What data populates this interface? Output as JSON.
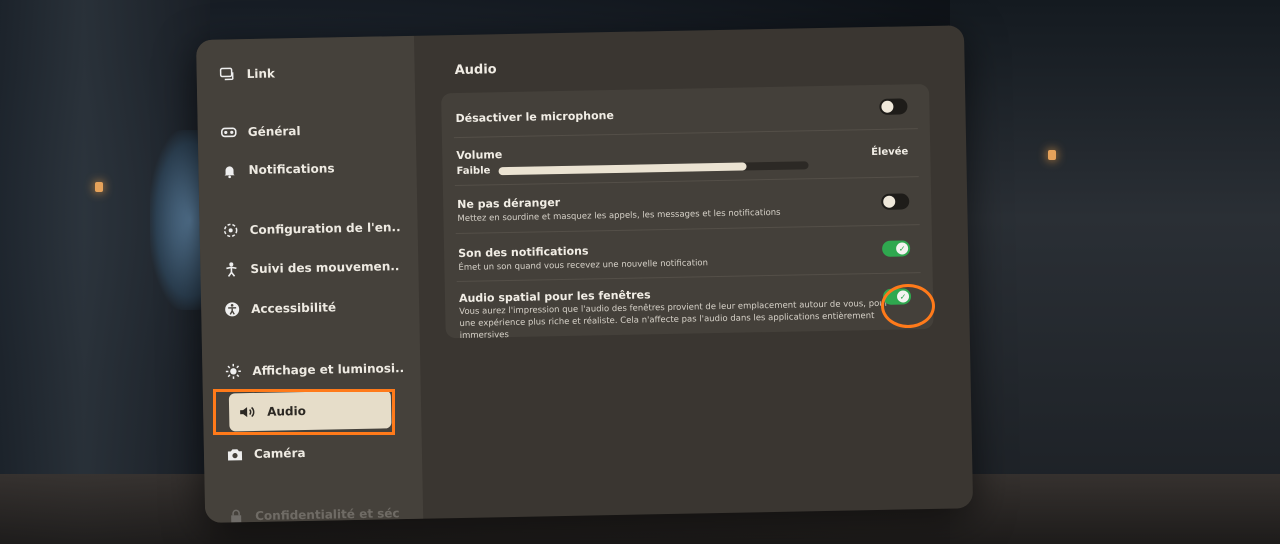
{
  "sidebar": {
    "items": [
      {
        "label": "Link",
        "icon": "link-icon"
      },
      {
        "label": "Général",
        "icon": "headset-icon"
      },
      {
        "label": "Notifications",
        "icon": "bell-icon"
      },
      {
        "label": "Configuration de l'en..",
        "icon": "boundary-icon"
      },
      {
        "label": "Suivi des mouvemen..",
        "icon": "movement-icon"
      },
      {
        "label": "Accessibilité",
        "icon": "accessibility-icon"
      },
      {
        "label": "Affichage et luminosi..",
        "icon": "brightness-icon"
      },
      {
        "label": "Audio",
        "icon": "speaker-icon",
        "active": true
      },
      {
        "label": "Caméra",
        "icon": "camera-icon"
      },
      {
        "label": "Confidentialité et séc",
        "icon": "lock-icon"
      }
    ]
  },
  "main": {
    "title": "Audio",
    "rows": {
      "mute_mic": {
        "title": "Désactiver le microphone",
        "enabled": false
      },
      "volume": {
        "title": "Volume",
        "low_label": "Faible",
        "high_label": "Élevée",
        "level": 0.8
      },
      "dnd": {
        "title": "Ne pas déranger",
        "desc": "Mettez en sourdine et masquez les appels, les messages et les notifications",
        "enabled": false
      },
      "notif_sound": {
        "title": "Son des notifications",
        "desc": "Émet un son quand vous recevez une nouvelle notification",
        "enabled": true
      },
      "spatial_audio": {
        "title": "Audio spatial pour les fenêtres",
        "desc": "Vous aurez l'impression que l'audio des fenêtres provient de leur emplacement autour de vous, pour une expérience plus riche et réaliste. Cela n'affecte pas l'audio dans les applications entièrement immersives",
        "enabled": true
      }
    }
  },
  "colors": {
    "accent_highlight": "#ff7a1a",
    "toggle_on": "#2fa84f",
    "panel": "#3a3631"
  }
}
